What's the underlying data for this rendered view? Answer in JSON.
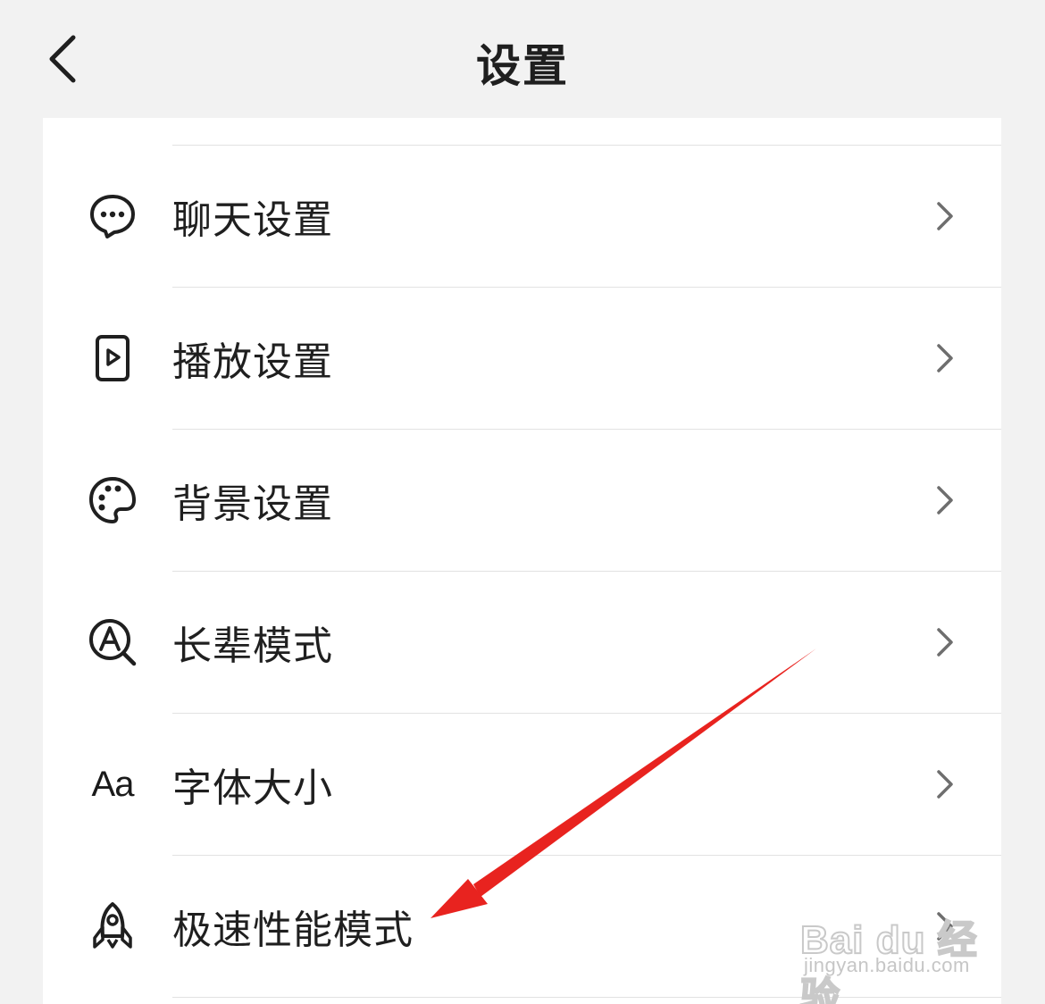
{
  "header": {
    "title": "设置",
    "back_icon": "chevron-left-icon"
  },
  "settings": {
    "items": [
      {
        "label": "聊天设置",
        "icon": "chat-bubble-icon"
      },
      {
        "label": "播放设置",
        "icon": "play-screen-icon"
      },
      {
        "label": "背景设置",
        "icon": "palette-icon"
      },
      {
        "label": "长辈模式",
        "icon": "magnify-a-icon"
      },
      {
        "label": "字体大小",
        "icon": "font-size-icon",
        "icon_text": "Aa"
      },
      {
        "label": "极速性能模式",
        "icon": "rocket-icon"
      }
    ]
  },
  "watermark": {
    "brand": "Bai du 经验",
    "url": "jingyan.baidu.com"
  },
  "colors": {
    "background": "#f2f2f2",
    "card": "#ffffff",
    "text": "#1f1f1f",
    "chevron": "#6e6e6e",
    "annotation_arrow": "#e8231f"
  }
}
